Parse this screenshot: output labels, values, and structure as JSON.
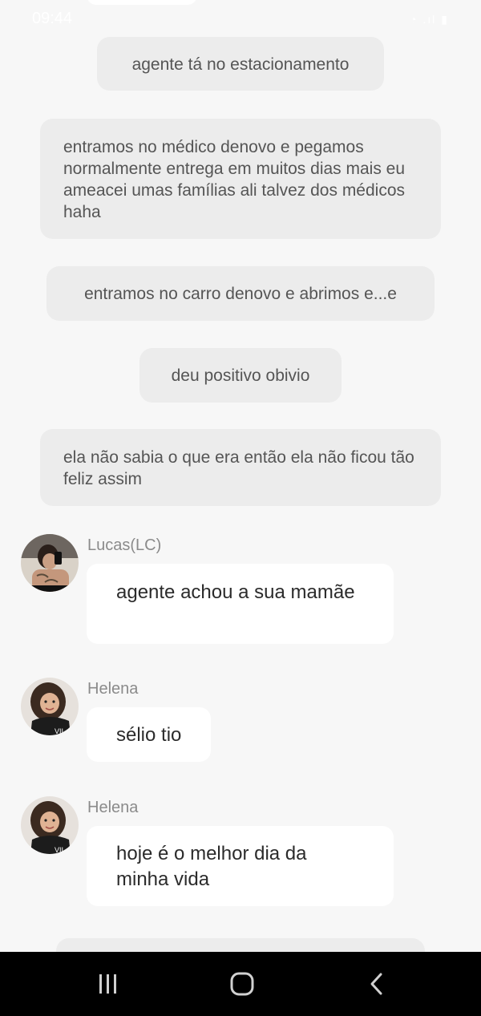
{
  "status_bar": {
    "time": "09:44",
    "icons": "◔ .ıl ▮"
  },
  "messages": [
    {
      "type": "narration",
      "text": "agente tá no estacionamento"
    },
    {
      "type": "narration",
      "text": "entramos no médico denovo e pegamos normalmente entrega em muitos dias mais eu ameacei umas famílias ali talvez dos médicos haha"
    },
    {
      "type": "narration",
      "text": "entramos no carro denovo e abrimos e...e"
    },
    {
      "type": "narration",
      "text": "deu positivo obivio"
    },
    {
      "type": "narration",
      "text": "ela não sabia o que era então ela não ficou tão feliz assim"
    },
    {
      "type": "chat",
      "sender": "Lucas(LC)",
      "text": "agente achou a sua mamãe"
    },
    {
      "type": "chat",
      "sender": "Helena",
      "text": "sélio tio"
    },
    {
      "type": "chat",
      "sender": "Helena",
      "text": "hoje é o melhor dia da minha vida"
    }
  ],
  "nav": {
    "recent_icon": "recent-apps-icon",
    "home_icon": "home-icon",
    "back_icon": "back-icon"
  }
}
